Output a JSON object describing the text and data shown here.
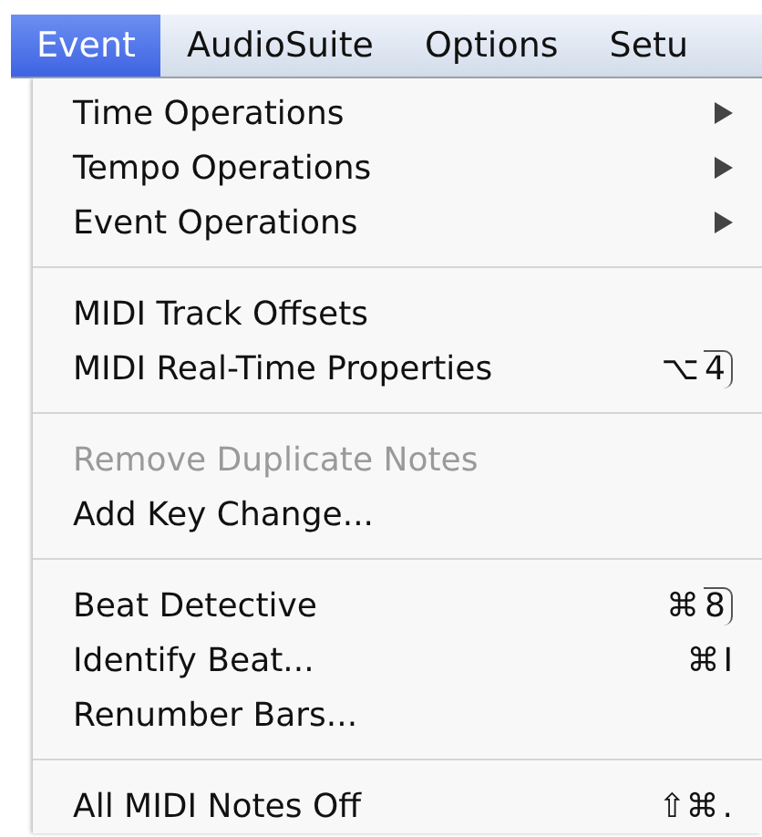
{
  "menubar": [
    {
      "label": "Event",
      "selected": true
    },
    {
      "label": "AudioSuite",
      "selected": false
    },
    {
      "label": "Options",
      "selected": false
    },
    {
      "label": "Setu",
      "selected": false
    }
  ],
  "menu": {
    "groups": [
      {
        "items": [
          {
            "label": "Time Operations",
            "submenu": true,
            "disabled": false
          },
          {
            "label": "Tempo Operations",
            "submenu": true,
            "disabled": false
          },
          {
            "label": "Event Operations",
            "submenu": true,
            "disabled": false
          }
        ]
      },
      {
        "items": [
          {
            "label": "MIDI Track Offsets",
            "submenu": false,
            "disabled": false
          },
          {
            "label": "MIDI Real-Time Properties",
            "submenu": false,
            "disabled": false,
            "shortcut": {
              "modifiers": "⌥",
              "key": "4",
              "keypad": true
            }
          }
        ]
      },
      {
        "items": [
          {
            "label": "Remove Duplicate Notes",
            "submenu": false,
            "disabled": true
          },
          {
            "label": "Add Key Change...",
            "submenu": false,
            "disabled": false
          }
        ]
      },
      {
        "items": [
          {
            "label": "Beat Detective",
            "submenu": false,
            "disabled": false,
            "shortcut": {
              "modifiers": "⌘",
              "key": "8",
              "keypad": true
            }
          },
          {
            "label": "Identify Beat...",
            "submenu": false,
            "disabled": false,
            "shortcut": {
              "modifiers": "⌘",
              "key": "I",
              "keypad": false
            }
          },
          {
            "label": "Renumber Bars...",
            "submenu": false,
            "disabled": false
          }
        ]
      },
      {
        "items": [
          {
            "label": "All MIDI Notes Off",
            "submenu": false,
            "disabled": false,
            "shortcut": {
              "modifiers": "⇧⌘",
              "key": ".",
              "keypad": false
            }
          }
        ]
      }
    ]
  }
}
